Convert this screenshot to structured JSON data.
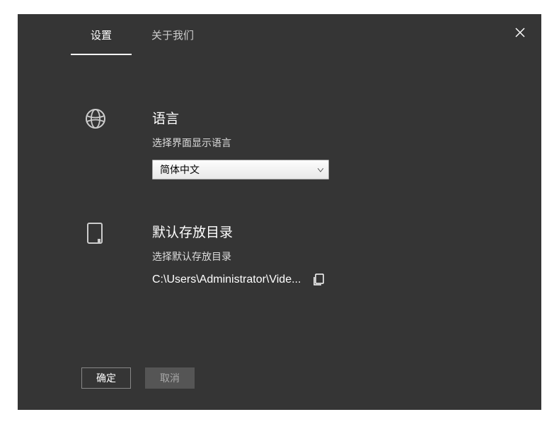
{
  "tabs": {
    "settings": "设置",
    "about": "关于我们"
  },
  "language": {
    "title": "语言",
    "subtitle": "选择界面显示语言",
    "selected": "简体中文"
  },
  "directory": {
    "title": "默认存放目录",
    "subtitle": "选择默认存放目录",
    "path": "C:\\Users\\Administrator\\Vide..."
  },
  "buttons": {
    "ok": "确定",
    "cancel": "取消"
  }
}
